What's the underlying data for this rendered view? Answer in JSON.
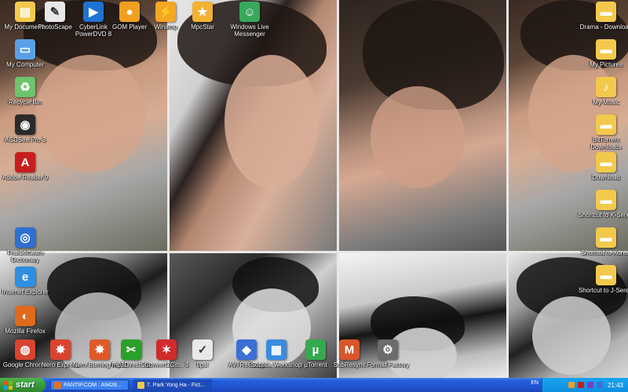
{
  "desktop": {
    "left_icons": [
      {
        "label": "My Documents",
        "color": "#f2c94c",
        "glyph": "▤",
        "icon": "folder-documents-icon"
      },
      {
        "label": "My Computer",
        "color": "#5aa0e6",
        "glyph": "▭",
        "icon": "computer-icon"
      },
      {
        "label": "Recycle Bin",
        "color": "#6cc46c",
        "glyph": "♻",
        "icon": "recycle-bin-icon"
      },
      {
        "label": "ACDSee Pro 3",
        "color": "#2b2b2b",
        "glyph": "◉",
        "icon": "acdsee-icon"
      },
      {
        "label": "Adobe Reader 9",
        "color": "#c81d1d",
        "glyph": "A",
        "icon": "adobe-reader-icon"
      },
      {
        "label": "ThaiSoftware Dictionary",
        "color": "#2f6fd0",
        "glyph": "◎",
        "icon": "dictionary-icon"
      },
      {
        "label": "Internet Explorer",
        "color": "#2e8fe0",
        "glyph": "e",
        "icon": "internet-explorer-icon"
      },
      {
        "label": "Mozilla Firefox",
        "color": "#e06a1c",
        "glyph": "◐",
        "icon": "firefox-icon"
      },
      {
        "label": "Google Chrome",
        "color": "#d9432f",
        "glyph": "◍",
        "icon": "chrome-icon"
      }
    ],
    "top_icons": [
      {
        "label": "PhotoScape",
        "color": "#e8e8e8",
        "glyph": "✎",
        "icon": "photoscape-icon"
      },
      {
        "label": "CyberLink PowerDVD 8",
        "color": "#1e73d1",
        "glyph": "▶",
        "icon": "powerdvd-icon"
      },
      {
        "label": "GOM Player",
        "color": "#f0a020",
        "glyph": "●",
        "icon": "gom-player-icon"
      },
      {
        "label": "Winamp",
        "color": "#f5a623",
        "glyph": "⚡",
        "icon": "winamp-icon"
      },
      {
        "label": "MpcStar",
        "color": "#f2b233",
        "glyph": "★",
        "icon": "mpcstar-icon"
      },
      {
        "label": "Windows Live Messenger",
        "color": "#38a85c",
        "glyph": "☺",
        "icon": "messenger-icon"
      }
    ],
    "right_icons": [
      {
        "label": "Drama - Download",
        "color": "#f2c94c",
        "glyph": "▬",
        "icon": "folder-icon"
      },
      {
        "label": "My Pictures",
        "color": "#f2c94c",
        "glyph": "▬",
        "icon": "folder-pictures-icon"
      },
      {
        "label": "My Music",
        "color": "#f2c94c",
        "glyph": "♪",
        "icon": "folder-music-icon"
      },
      {
        "label": "BitTorrent Downloads",
        "color": "#f2c94c",
        "glyph": "▬",
        "icon": "folder-icon"
      },
      {
        "label": "Download",
        "color": "#f2c94c",
        "glyph": "▬",
        "icon": "folder-icon"
      },
      {
        "label": "Shortcut to K-Sereis",
        "color": "#f2c94c",
        "glyph": "▬",
        "icon": "folder-shortcut-icon"
      },
      {
        "label": "Shortcut to Koreal",
        "color": "#f2c94c",
        "glyph": "▬",
        "icon": "folder-shortcut-icon"
      },
      {
        "label": "Shortcut to J-Sereis",
        "color": "#f2c94c",
        "glyph": "▬",
        "icon": "folder-shortcut-icon"
      }
    ],
    "bottom_icons": [
      {
        "label": "Nero Express",
        "color": "#d9432f",
        "glyph": "✸",
        "icon": "nero-express-icon"
      },
      {
        "label": "Nero Burning ROM",
        "color": "#e05a28",
        "glyph": "✸",
        "icon": "nero-burning-rom-icon"
      },
      {
        "label": "mp3DirectCut",
        "color": "#2aa02a",
        "glyph": "✂",
        "icon": "mp3directcut-icon"
      },
      {
        "label": "Convert2Co... 3",
        "color": "#d12b2b",
        "glyph": "✶",
        "icon": "converter-icon"
      },
      {
        "label": "tips!",
        "color": "#e9e9e9",
        "glyph": "✓",
        "icon": "tips-icon"
      },
      {
        "label": "AVI ReComp",
        "color": "#3b6fd6",
        "glyph": "◆",
        "icon": "avirecomp-icon"
      },
      {
        "label": "Subtitle Workshop",
        "color": "#3b8be0",
        "glyph": "▦",
        "icon": "subtitle-workshop-icon"
      },
      {
        "label": "µTorrent",
        "color": "#36a84f",
        "glyph": "µ",
        "icon": "utorrent-icon"
      },
      {
        "label": "SubResync",
        "color": "#d8572a",
        "glyph": "M",
        "icon": "subresync-icon"
      },
      {
        "label": "Format Factory",
        "color": "#6c6c6c",
        "glyph": "⚙",
        "icon": "format-factory-icon"
      }
    ]
  },
  "taskbar": {
    "start_label": "start",
    "tasks": [
      {
        "label": "PANTIP.COM : A9428...",
        "color": "#e2711d",
        "active": false
      },
      {
        "label": "7. Park Yong Ha - Fict...",
        "color": "#f2c94c",
        "active": true
      }
    ],
    "language": "EN",
    "tray_colors": [
      "#f0a020",
      "#c81d1d",
      "#7a3fbf",
      "#3b6fd6"
    ],
    "clock": "21:43"
  }
}
